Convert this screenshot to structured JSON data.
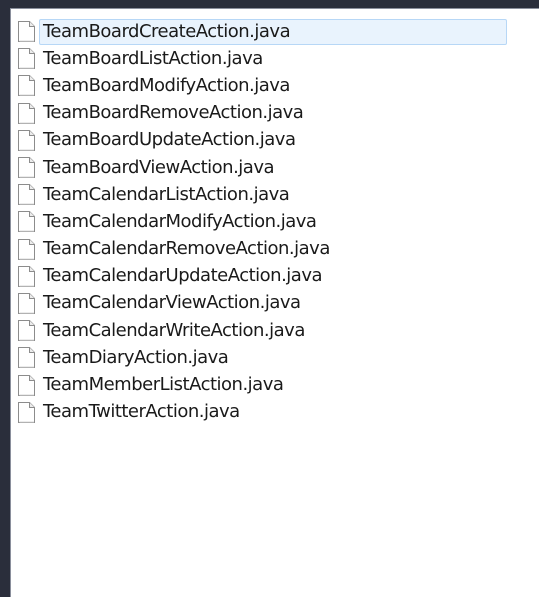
{
  "files": [
    {
      "name": "TeamBoardCreateAction.java",
      "icon": "java-file-icon",
      "selected": true
    },
    {
      "name": "TeamBoardListAction.java",
      "icon": "java-file-icon",
      "selected": false
    },
    {
      "name": "TeamBoardModifyAction.java",
      "icon": "java-file-icon",
      "selected": false
    },
    {
      "name": "TeamBoardRemoveAction.java",
      "icon": "java-file-icon",
      "selected": false
    },
    {
      "name": "TeamBoardUpdateAction.java",
      "icon": "java-file-icon",
      "selected": false
    },
    {
      "name": "TeamBoardViewAction.java",
      "icon": "java-file-icon",
      "selected": false
    },
    {
      "name": "TeamCalendarListAction.java",
      "icon": "java-file-icon",
      "selected": false
    },
    {
      "name": "TeamCalendarModifyAction.java",
      "icon": "java-file-icon",
      "selected": false
    },
    {
      "name": "TeamCalendarRemoveAction.java",
      "icon": "java-file-icon",
      "selected": false
    },
    {
      "name": "TeamCalendarUpdateAction.java",
      "icon": "java-file-icon",
      "selected": false
    },
    {
      "name": "TeamCalendarViewAction.java",
      "icon": "java-file-icon",
      "selected": false
    },
    {
      "name": "TeamCalendarWriteAction.java",
      "icon": "java-file-icon",
      "selected": false
    },
    {
      "name": "TeamDiaryAction.java",
      "icon": "java-file-icon",
      "selected": false
    },
    {
      "name": "TeamMemberListAction.java",
      "icon": "java-file-icon",
      "selected": false
    },
    {
      "name": "TeamTwitterAction.java",
      "icon": "java-file-icon",
      "selected": false
    }
  ],
  "colors": {
    "background": "#2a2e3b",
    "pane": "#ffffff",
    "selection_fill": "#e9f3fd",
    "selection_border": "#b7d7f6",
    "text": "#1a1a1a"
  }
}
